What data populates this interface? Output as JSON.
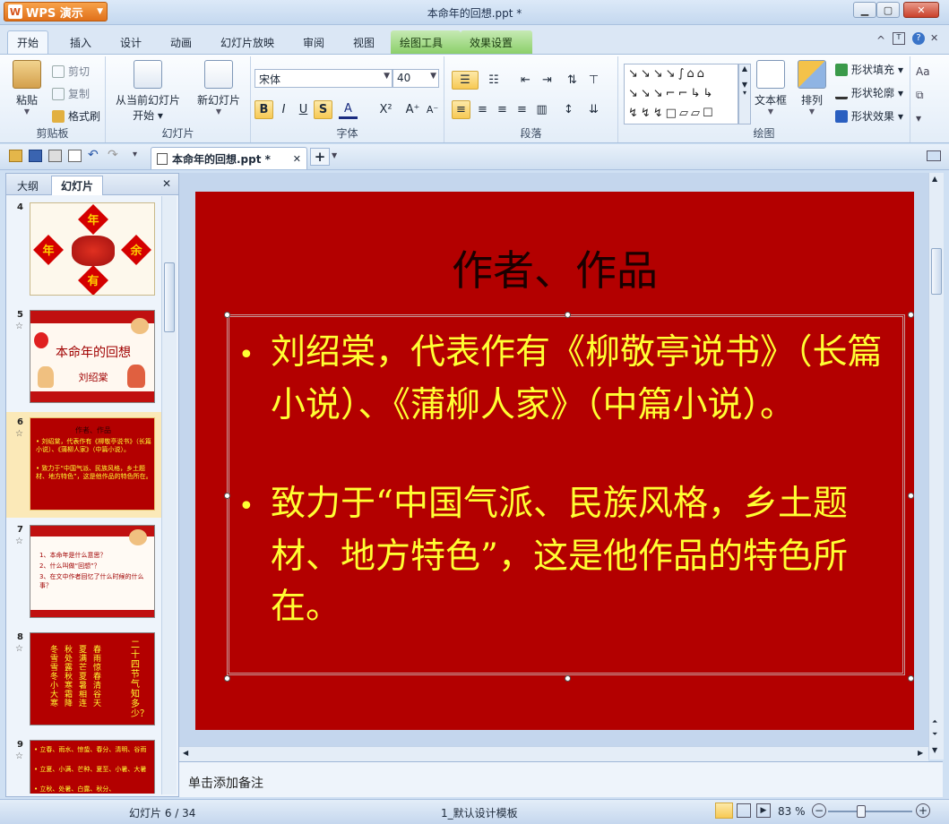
{
  "window": {
    "title": "本命年的回想.ppt *",
    "app_name": "WPS 演示"
  },
  "tabs": [
    "开始",
    "插入",
    "设计",
    "动画",
    "幻灯片放映",
    "审阅",
    "视图",
    "绘图工具",
    "效果设置"
  ],
  "ribbon": {
    "clipboard": {
      "paste": "粘贴",
      "cut": "剪切",
      "copy": "复制",
      "format_painter": "格式刷",
      "label": "剪贴板"
    },
    "slides": {
      "from_current": "从当前幻灯片",
      "start": "开始",
      "new_slide": "新幻灯片",
      "label": "幻灯片"
    },
    "font": {
      "name": "宋体",
      "size": "40",
      "label": "字体"
    },
    "paragraph": {
      "label": "段落"
    },
    "drawing": {
      "textbox": "文本框",
      "arrange": "排列",
      "shape_fill": "形状填充",
      "shape_outline": "形状轮廓",
      "shape_effect": "形状效果",
      "label": "绘图"
    }
  },
  "doc_tab": {
    "name": "本命年的回想.ppt *"
  },
  "left_panel": {
    "tabs": [
      "大纲",
      "幻灯片"
    ],
    "thumbs": [
      {
        "num": "4",
        "chars": [
          "年",
          "年",
          "余",
          "有"
        ]
      },
      {
        "num": "5",
        "title": "本命年的回想",
        "author": "刘绍棠"
      },
      {
        "num": "6",
        "title": "作者、作品",
        "lines": [
          "• 刘绍棠，代表作有《柳敬亭说书》（长篇小说）、《蒲柳人家》（中篇小说）。",
          "• 致力于“中国气派、民族风格，乡土题材、地方特色”，这是他作品的特色所在。"
        ]
      },
      {
        "num": "7",
        "lines": [
          "1、本命年是什么意思？",
          "2、什么叫做“回想”？",
          "3、在文中作者回忆了什么时候的什么事？"
        ]
      },
      {
        "num": "8",
        "cols": [
          "春雨惊春清谷天",
          "夏满芒夏暑相连",
          "秋处露秋寒霜降",
          "冬雪雪冬小大寒"
        ],
        "side": "二十四节气知多少？"
      },
      {
        "num": "9",
        "lines": [
          "• 立春、雨水、惊蛰、春分、清明、谷雨",
          "• 立夏、小满、芒种、夏至、小暑、大暑",
          "• 立秋、处暑、白露、秋分、"
        ]
      }
    ]
  },
  "slide": {
    "title": "作者、作品",
    "bullets": [
      "刘绍棠，代表作有《柳敬亭说书》（长篇小说）、《蒲柳人家》（中篇小说）。",
      "致力于“中国气派、民族风格，乡土题材、地方特色”，这是他作品的特色所在。"
    ]
  },
  "notes": {
    "placeholder": "单击添加备注"
  },
  "status": {
    "slide_count": "幻灯片 6 / 34",
    "template": "1_默认设计模板",
    "zoom": "83 %"
  },
  "colors": {
    "slide_bg": "#b30000",
    "slide_text": "#ffff33"
  }
}
